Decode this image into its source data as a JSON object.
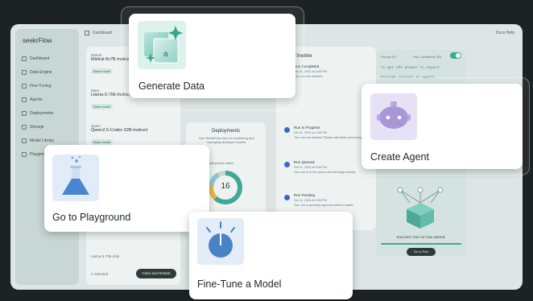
{
  "app": {
    "logo_main": "seekr",
    "logo_sub": "Flow",
    "breadcrumb": "Dashboard",
    "topbar_right": "Docs   Help"
  },
  "sidebar": {
    "items": [
      {
        "label": "Dashboard"
      },
      {
        "label": "Data Engine"
      },
      {
        "label": "Fine-Tuning"
      },
      {
        "label": "Agents"
      },
      {
        "label": "Deployments"
      },
      {
        "label": "Storage"
      },
      {
        "label": "Model Library"
      },
      {
        "label": "Playground"
      }
    ]
  },
  "models_panel": {
    "rows": [
      {
        "provider": "Mistral",
        "name": "Mistral-8x7B-Instruct",
        "tag": "Base model"
      },
      {
        "provider": "Meta",
        "name": "Llama-3-70b-Instruct",
        "tag": "Base model"
      },
      {
        "provider": "Qwen",
        "name": "Qwen2.5-Coder-32B-Instruct",
        "tag": "Base model"
      }
    ],
    "bottom_row": "Llama-3-70b-chat",
    "selected": "2 Selected",
    "button": "Clear and Restart"
  },
  "deployments_panel": {
    "title": "Deployments",
    "desc": "Your SeekrFlow hub for monitoring and managing deployed models",
    "subtitle": "Deployment status",
    "count": "16"
  },
  "timeline_panel": {
    "title": "Timeline",
    "items": [
      {
        "title": "Run Completed",
        "date": "Oct 11, 2024 at 3:45 PM",
        "desc": "Your run has finished."
      },
      {
        "title": "Run In Progress",
        "date": "Oct 11, 2024 at 3:45 PM",
        "desc": "Your run has started. Please wait while processing."
      },
      {
        "title": "Run Queued",
        "date": "Oct 11, 2024 at 3:45 PM",
        "desc": "Your run is in the queue and will begin shortly."
      },
      {
        "title": "Run Pending",
        "date": "Oct 11, 2024 at 3:45 PM",
        "desc": "Your run is pending approval before it starts."
      }
    ]
  },
  "agent_panel": {
    "label_left": "Prompt (P)",
    "label_right": "Use Confidence (R)",
    "code_line_1": "to get the answer to expert",
    "code_line_2": "Provide   context  to  agents",
    "success": "Success! Your run has started.",
    "button": "Go to Run"
  },
  "cards": {
    "generate_data": "Generate Data",
    "create_agent": "Create Agent",
    "playground": "Go to Playground",
    "fine_tune": "Fine-Tune a Model"
  },
  "colors": {
    "background": "#1d2224",
    "app": "#dde6e4",
    "accent_teal": "#3fa897",
    "accent_blue": "#3c66c9",
    "agent_purple": "#9b8ac9"
  }
}
